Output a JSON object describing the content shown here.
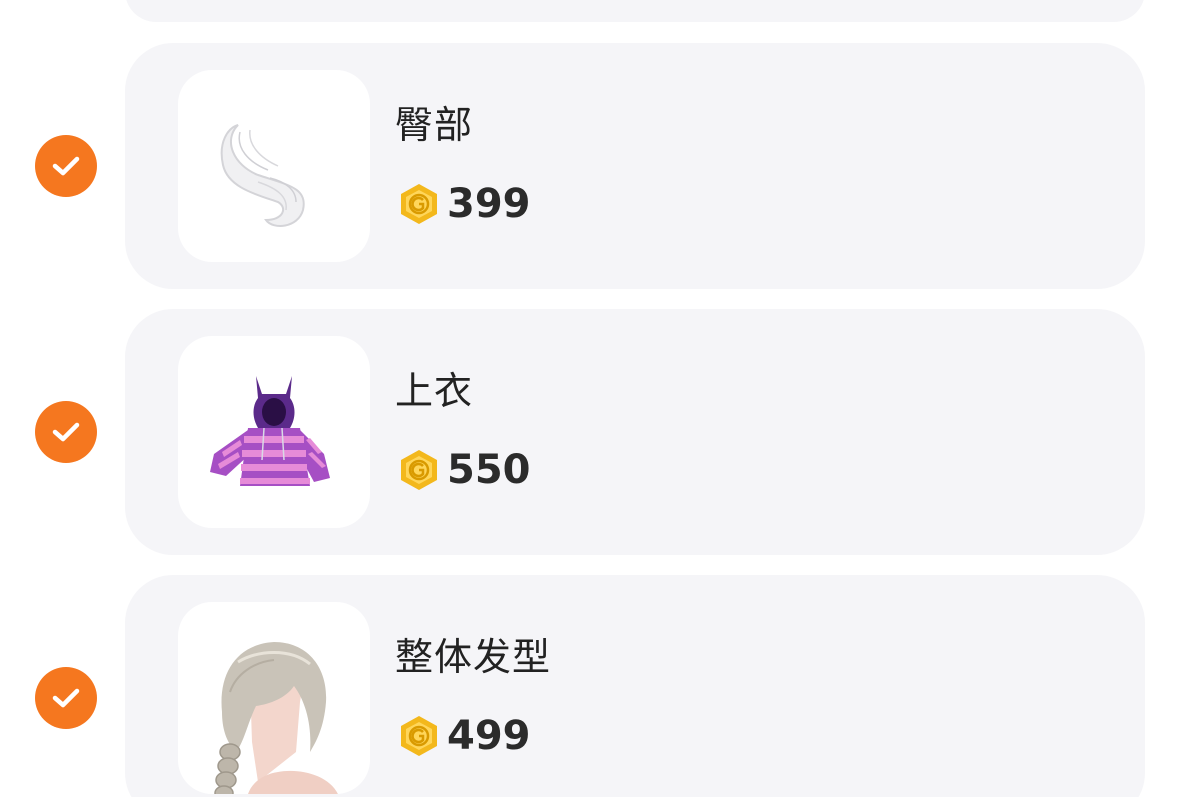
{
  "items": [
    {
      "title": "臀部",
      "price": "399",
      "image_icon": "tail-icon",
      "selected": true
    },
    {
      "title": "上衣",
      "price": "550",
      "image_icon": "hoodie-icon",
      "selected": true
    },
    {
      "title": "整体发型",
      "price": "499",
      "image_icon": "hair-icon",
      "selected": true
    }
  ],
  "colors": {
    "check_bg": "#f5771f",
    "card_bg": "#f5f5f8",
    "coin": "#f3b81c",
    "price_text": "#2b2b2b"
  },
  "icons": {
    "selected": "checkmark-circle-icon",
    "currency": "gold-coin-icon"
  }
}
